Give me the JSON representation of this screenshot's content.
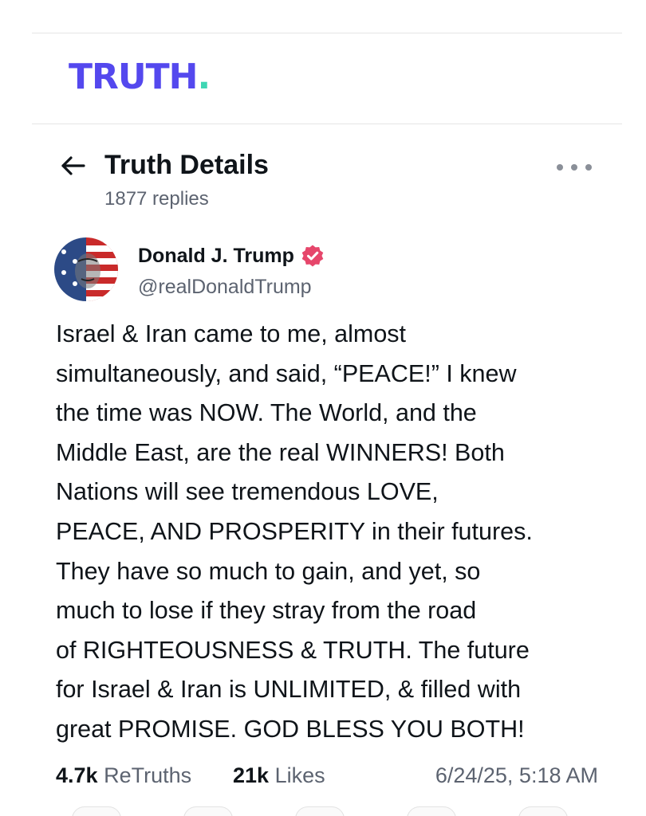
{
  "brand": {
    "logo_word": "TRUTH",
    "logo_dot": ".",
    "primary_color": "#5448ee",
    "accent_color": "#3ed6b3"
  },
  "header": {
    "back_icon": "arrow-left-icon",
    "title": "Truth Details",
    "replies": "1877 replies",
    "more_icon": "more-horizontal-icon"
  },
  "post": {
    "author_name": "Donald J. Trump",
    "verified_icon": "verified-badge-icon",
    "verified_color": "#e6466b",
    "handle": "@realDonaldTrump",
    "body_lines": [
      "Israel & Iran came to me, almost",
      "simultaneously, and said, “PEACE!” I knew",
      "the time was NOW. The World, and the",
      "Middle East, are the real WINNERS! Both",
      "Nations will see tremendous LOVE,",
      "PEACE, AND PROSPERITY in their futures.",
      "They have so much to gain, and yet, so",
      "much to lose if they stray from the road",
      "of RIGHTEOUSNESS & TRUTH. The future",
      "for Israel & Iran is UNLIMITED, & filled with",
      "great PROMISE. GOD BLESS YOU BOTH!"
    ],
    "retruths_count": "4.7k",
    "retruths_label": "ReTruths",
    "likes_count": "21k",
    "likes_label": "Likes",
    "timestamp": "6/24/25, 5:18 AM"
  }
}
